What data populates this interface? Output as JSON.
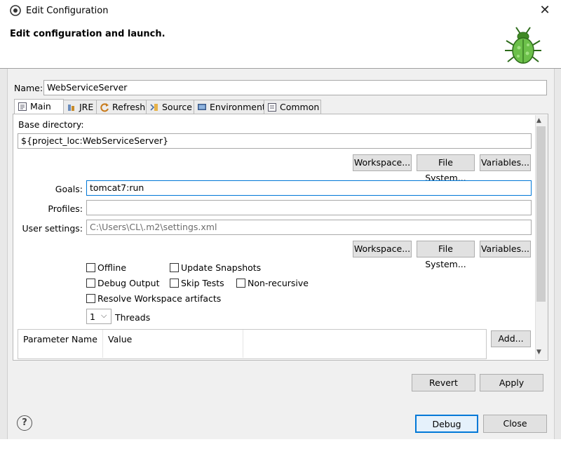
{
  "window": {
    "title": "Edit Configuration",
    "close_icon": "close-icon"
  },
  "banner": {
    "heading": "Edit configuration and launch."
  },
  "name": {
    "label": "Name:",
    "value": "WebServiceServer"
  },
  "tabs": [
    {
      "label": "Main",
      "icon": "main-tab-icon",
      "active": true
    },
    {
      "label": "JRE",
      "icon": "jre-icon"
    },
    {
      "label": "Refresh",
      "icon": "refresh-icon"
    },
    {
      "label": "Source",
      "icon": "source-icon"
    },
    {
      "label": "Environment",
      "icon": "environment-icon"
    },
    {
      "label": "Common",
      "icon": "common-icon"
    }
  ],
  "main": {
    "base_dir_label": "Base directory:",
    "base_dir_value": "${project_loc:WebServiceServer}",
    "buttons1": {
      "workspace": "Workspace...",
      "filesystem": "File System...",
      "variables": "Variables..."
    },
    "goals_label": "Goals:",
    "goals_value": "tomcat7:run",
    "profiles_label": "Profiles:",
    "profiles_value": "",
    "user_settings_label": "User settings:",
    "user_settings_value": "C:\\Users\\CL\\.m2\\settings.xml",
    "buttons2": {
      "workspace": "Workspace...",
      "filesystem": "File System...",
      "variables": "Variables..."
    },
    "checkboxes": {
      "offline": "Offline",
      "update_snapshots": "Update Snapshots",
      "debug_output": "Debug Output",
      "skip_tests": "Skip Tests",
      "non_recursive": "Non-recursive",
      "resolve_workspace": "Resolve Workspace artifacts"
    },
    "threads_value": "1",
    "threads_label": "Threads",
    "table": {
      "col_name": "Parameter Name",
      "col_value": "Value"
    },
    "add_button": "Add..."
  },
  "actions": {
    "revert": "Revert",
    "apply": "Apply"
  },
  "footer": {
    "help": "?",
    "debug": "Debug",
    "close": "Close"
  },
  "colors": {
    "focus_border": "#0078d7",
    "primary_border": "#0078d7"
  }
}
